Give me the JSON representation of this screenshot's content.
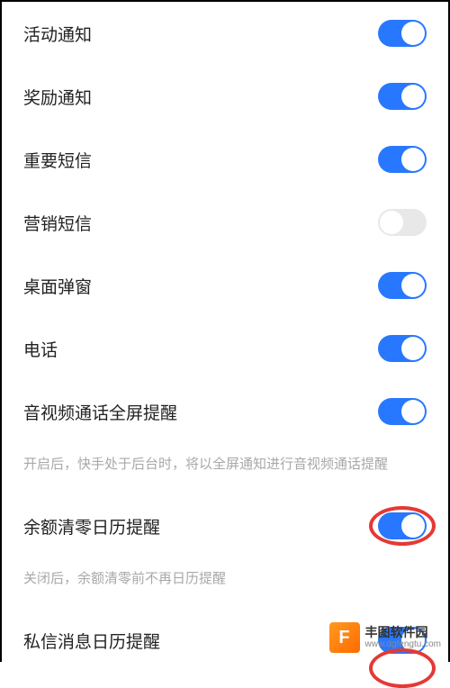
{
  "settings": [
    {
      "label": "活动通知",
      "state": "on",
      "highlight": false
    },
    {
      "label": "奖励通知",
      "state": "on",
      "highlight": false
    },
    {
      "label": "重要短信",
      "state": "on",
      "highlight": false
    },
    {
      "label": "营销短信",
      "state": "off",
      "highlight": false
    },
    {
      "label": "桌面弹窗",
      "state": "on",
      "highlight": false
    },
    {
      "label": "电话",
      "state": "on",
      "highlight": false
    },
    {
      "label": "音视频通话全屏提醒",
      "state": "on",
      "highlight": false,
      "desc": "开启后，快手处于后台时，将以全屏通知进行音视频通话提醒"
    },
    {
      "label": "余额清零日历提醒",
      "state": "on",
      "highlight": true,
      "desc": "关闭后，余额清零前不再日历提醒"
    },
    {
      "label": "私信消息日历提醒",
      "state": "on",
      "highlight": true
    }
  ],
  "watermark": {
    "logo": "F",
    "title": "丰图软件园",
    "url": "www.dgfengtu.com"
  }
}
